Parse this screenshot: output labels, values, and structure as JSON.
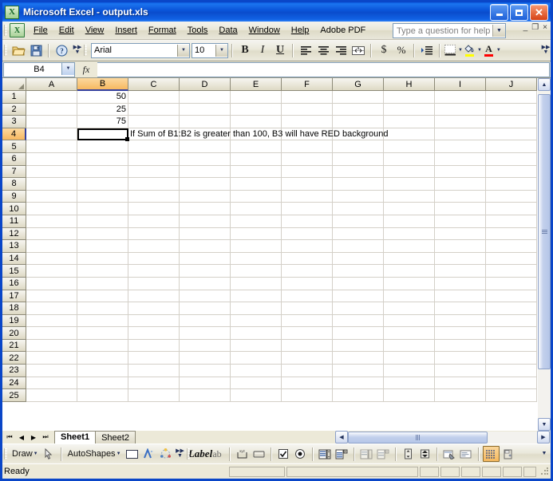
{
  "window": {
    "title": "Microsoft Excel - output.xls",
    "app_icon": "excel-icon",
    "minimize_label": "Minimize",
    "maximize_label": "Maximize",
    "close_label": "Close"
  },
  "menubar": {
    "items": [
      {
        "label": "File",
        "accel": "F"
      },
      {
        "label": "Edit",
        "accel": "E"
      },
      {
        "label": "View",
        "accel": "V"
      },
      {
        "label": "Insert",
        "accel": "I"
      },
      {
        "label": "Format",
        "accel": "o"
      },
      {
        "label": "Tools",
        "accel": "T"
      },
      {
        "label": "Data",
        "accel": "D"
      },
      {
        "label": "Window",
        "accel": "W"
      },
      {
        "label": "Help",
        "accel": "H"
      },
      {
        "label": "Adobe PDF",
        "accel": "b"
      }
    ],
    "help_search": {
      "placeholder": "Type a question for help",
      "value": ""
    },
    "doc_minimize": "_",
    "doc_restore": "❐",
    "doc_close": "×"
  },
  "toolbar": {
    "open_label": "Open",
    "save_label": "Save",
    "help_label": "Microsoft Excel Help",
    "font_name": "Arial",
    "font_size": "10",
    "bold_label": "B",
    "italic_label": "I",
    "underline_label": "U",
    "align_left_label": "Align Left",
    "align_center_label": "Center",
    "align_right_label": "Align Right",
    "merge_label": "Merge and Center",
    "currency_label": "$",
    "percent_label": "%",
    "indent_label": "Increase Indent",
    "borders_label": "Borders",
    "fill_color_label": "Fill Color",
    "font_color_label": "Font Color",
    "fill_color": "#ffff00",
    "font_color": "#ff0000",
    "overflow_label": "Toolbar Options"
  },
  "formula_bar": {
    "name_box": "B4",
    "fx_label": "fx",
    "formula_value": ""
  },
  "sheet": {
    "columns": [
      "A",
      "B",
      "C",
      "D",
      "E",
      "F",
      "G",
      "H",
      "I",
      "J"
    ],
    "selected_column": "B",
    "selected_row": 4,
    "active_cell": "B4",
    "rows": [
      {
        "n": "1",
        "cells": {
          "B": "50"
        }
      },
      {
        "n": "2",
        "cells": {
          "B": "25"
        }
      },
      {
        "n": "3",
        "cells": {
          "B": "75"
        }
      },
      {
        "n": "4",
        "cells": {
          "C": "If Sum of B1:B2 is greater than 100, B3 will have RED background"
        }
      },
      {
        "n": "5",
        "cells": {}
      },
      {
        "n": "6",
        "cells": {}
      },
      {
        "n": "7",
        "cells": {}
      },
      {
        "n": "8",
        "cells": {}
      },
      {
        "n": "9",
        "cells": {}
      },
      {
        "n": "10",
        "cells": {}
      },
      {
        "n": "11",
        "cells": {}
      },
      {
        "n": "12",
        "cells": {}
      },
      {
        "n": "13",
        "cells": {}
      },
      {
        "n": "14",
        "cells": {}
      },
      {
        "n": "15",
        "cells": {}
      },
      {
        "n": "16",
        "cells": {}
      },
      {
        "n": "17",
        "cells": {}
      },
      {
        "n": "18",
        "cells": {}
      },
      {
        "n": "19",
        "cells": {}
      },
      {
        "n": "20",
        "cells": {}
      },
      {
        "n": "21",
        "cells": {}
      },
      {
        "n": "22",
        "cells": {}
      },
      {
        "n": "23",
        "cells": {}
      },
      {
        "n": "24",
        "cells": {}
      },
      {
        "n": "25",
        "cells": {}
      }
    ],
    "numeric_columns": [
      "B"
    ],
    "overflow_columns": [
      "C"
    ]
  },
  "tabs": {
    "first_label": "First Sheet",
    "prev_label": "Previous Sheet",
    "next_label": "Next Sheet",
    "last_label": "Last Sheet",
    "sheets": [
      {
        "label": "Sheet1",
        "active": true
      },
      {
        "label": "Sheet2",
        "active": false
      }
    ]
  },
  "drawing_toolbar": {
    "draw_label": "Draw",
    "select_label": "Select Objects",
    "autoshapes_label": "AutoShapes",
    "rectangle_label": "Rectangle",
    "wordart_label": "Insert WordArt",
    "diagram_label": "Insert Diagram",
    "form_label_label": "Label",
    "form_textbox_label": "Text Box",
    "form_spinner_label": "Spinner",
    "form_button_label": "Button",
    "form_checkbox_label": "Check Box",
    "form_option_label": "Option Button",
    "form_listbox_label": "List Box",
    "form_combobox_label": "Combo Box",
    "form_listedit_label": "Combination List-Edit",
    "form_dropedit_label": "Combination Drop-Down Edit",
    "form_scroll_label": "Scroll Bar",
    "form_spin_label": "Spin Button",
    "control_properties_label": "Control Properties",
    "view_code_label": "View Code",
    "toggle_grid_label": "Toggle Grid",
    "design_mode_label": "Design Mode",
    "overflow_label": "Toolbar Options"
  },
  "statusbar": {
    "status": "Ready",
    "panes": [
      "",
      "",
      "",
      "",
      "",
      "",
      "",
      ""
    ]
  }
}
